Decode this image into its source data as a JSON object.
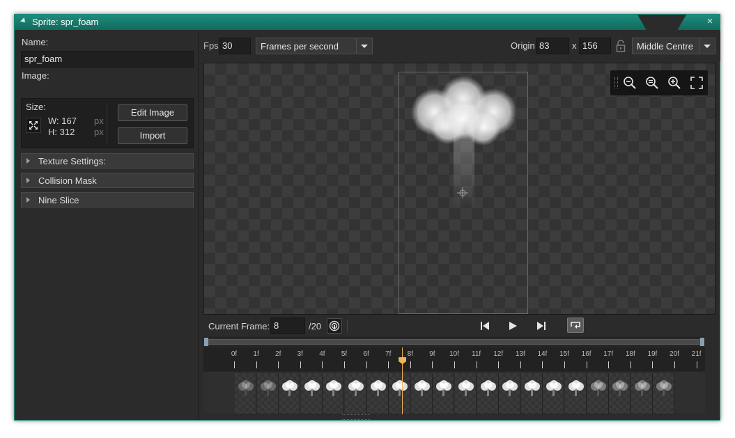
{
  "window": {
    "title": "Sprite: spr_foam",
    "close_glyph": "×"
  },
  "left_panel": {
    "name_label": "Name:",
    "name_value": "spr_foam",
    "image_label": "Image:",
    "size_label": "Size:",
    "width_label": "W: 167",
    "height_label": "H: 312",
    "unit_w": "px",
    "unit_h": "px",
    "edit_image_button": "Edit Image",
    "import_button": "Import",
    "sections": [
      {
        "label": "Texture Settings:"
      },
      {
        "label": "Collision Mask"
      },
      {
        "label": "Nine Slice"
      }
    ]
  },
  "toolbar": {
    "fps_label": "Fps",
    "fps_value": "30",
    "speed_mode": "Frames per second",
    "origin_label": "Origin",
    "origin_x": "83",
    "origin_sep": "x",
    "origin_y": "156",
    "origin_preset": "Middle Centre"
  },
  "playback": {
    "current_frame_label": "Current Frame:",
    "current_frame_value": "8",
    "total_frames": "/20",
    "loop_enabled": true
  },
  "timeline": {
    "frame_labels": [
      "0f",
      "1f",
      "2f",
      "3f",
      "4f",
      "5f",
      "6f",
      "7f",
      "8f",
      "9f",
      "10f",
      "11f",
      "12f",
      "13f",
      "14f",
      "15f",
      "16f",
      "17f",
      "18f",
      "19f",
      "20f",
      "21f"
    ],
    "playhead_frame": 7,
    "frame_count": 20
  },
  "colors": {
    "accent": "#1a8a78",
    "playhead": "#f0b25a",
    "panel": "#2b2b2b"
  },
  "icons": {
    "resize": "expand-arrows-icon",
    "lock": "unlock-icon",
    "zoom_out": "zoom-out-icon",
    "zoom_reset": "zoom-reset-icon",
    "zoom_in": "zoom-in-icon",
    "fit": "fullscreen-icon",
    "onion": "onion-skin-icon",
    "first": "skip-back-icon",
    "play": "play-icon",
    "last": "skip-forward-icon",
    "loop": "loop-icon"
  }
}
